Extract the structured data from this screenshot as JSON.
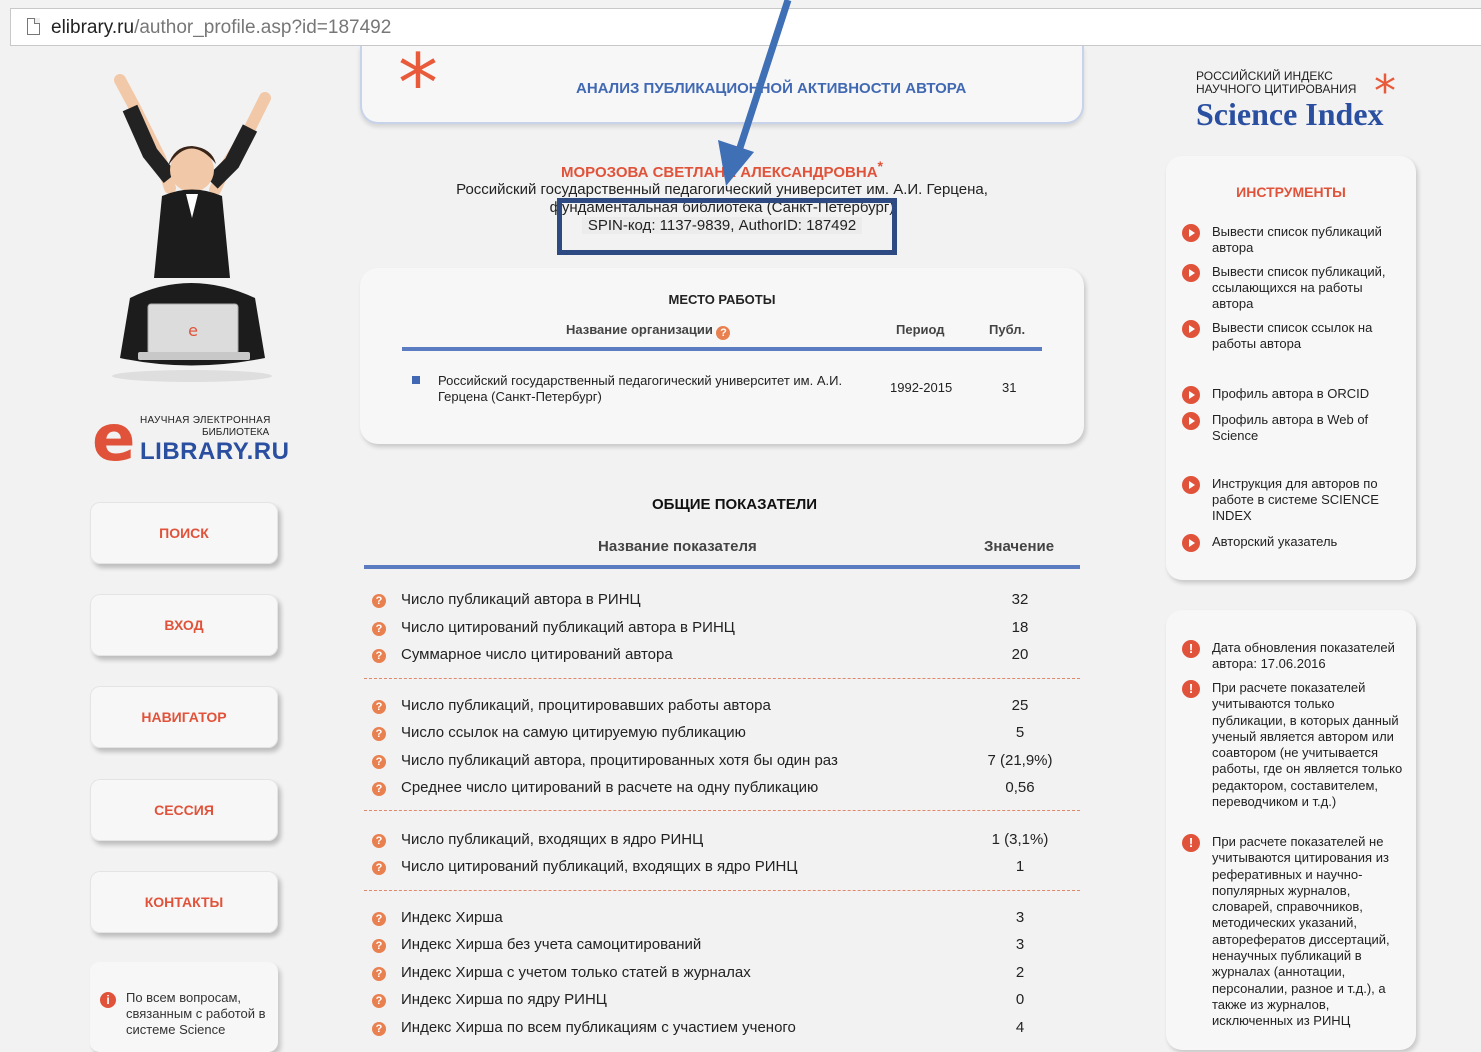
{
  "browser": {
    "url_host": "elibrary.ru",
    "url_path": "/author_profile.asp?id=187492"
  },
  "left": {
    "logo": {
      "line1": "НАУЧНАЯ ЭЛЕКТРОННАЯ",
      "line2": "БИБЛИОТЕКА",
      "brand": "LIBRARY.RU"
    },
    "nav": [
      "ПОИСК",
      "ВХОД",
      "НАВИГАТОР",
      "СЕССИЯ",
      "КОНТАКТЫ"
    ],
    "info": "По всем вопросам, связанным с работой в системе Science"
  },
  "header": {
    "title": "АНАЛИЗ ПУБЛИКАЦИОННОЙ АКТИВНОСТИ АВТОРА"
  },
  "author": {
    "name": "МОРОЗОВА СВЕТЛАНА АЛЕКСАНДРОВНА",
    "star": "*",
    "aff1": "Российский государственный педагогический университет им. А.И. Герцена,",
    "aff2": "фундаментальная библиотека (Санкт-Петербург)",
    "spin": "SPIN-код: 1137-9839, AuthorID: 187492"
  },
  "work": {
    "title": "МЕСТО РАБОТЫ",
    "col_name": "Название организации",
    "col_period": "Период",
    "col_pub": "Публ.",
    "org": "Российский государственный педагогический университет им. А.И. Герцена (Санкт-Петербург)",
    "period": "1992-2015",
    "pub": "31"
  },
  "general": {
    "title": "ОБЩИЕ ПОКАЗАТЕЛИ",
    "col_name": "Название показателя",
    "col_value": "Значение",
    "rows": [
      {
        "label": "Число публикаций автора в РИНЦ",
        "value": "32"
      },
      {
        "label": "Число цитирований публикаций автора в РИНЦ",
        "value": "18"
      },
      {
        "label": "Суммарное число цитирований автора",
        "value": "20"
      },
      {
        "label": "Число публикаций, процитировавших работы автора",
        "value": "25"
      },
      {
        "label": "Число ссылок на самую цитируемую публикацию",
        "value": "5"
      },
      {
        "label": "Число публикаций автора, процитированных хотя бы один раз",
        "value": "7 (21,9%)"
      },
      {
        "label": "Среднее число цитирований в расчете на одну публикацию",
        "value": "0,56"
      },
      {
        "label": "Число публикаций, входящих в ядро РИНЦ",
        "value": "1 (3,1%)"
      },
      {
        "label": "Число цитирований публикаций, входящих в ядро РИНЦ",
        "value": "1"
      },
      {
        "label": "Индекс Хирша",
        "value": "3"
      },
      {
        "label": "Индекс Хирша без учета самоцитирований",
        "value": "3"
      },
      {
        "label": "Индекс Хирша с учетом только статей в журналах",
        "value": "2"
      },
      {
        "label": "Индекс Хирша по ядру РИНЦ",
        "value": "0"
      },
      {
        "label": "Индекс Хирша по всем публикациям с участием ученого",
        "value": "4"
      }
    ]
  },
  "science_index": {
    "line1": "РОССИЙСКИЙ ИНДЕКС",
    "line2": "НАУЧНОГО ЦИТИРОВАНИЯ",
    "brand": "Science Index"
  },
  "tools": {
    "title": "ИНСТРУМЕНТЫ",
    "items": [
      "Вывести список публикаций автора",
      "Вывести список публикаций, ссылающихся на работы автора",
      "Вывести список ссылок на работы автора",
      "Профиль автора в ORCID",
      "Профиль автора в Web of Science",
      "Инструкция для авторов по работе в системе SCIENCE INDEX",
      "Авторский указатель"
    ]
  },
  "notes": [
    "Дата обновления показателей автора: 17.06.2016",
    "При расчете показателей учитываются только публикации, в которых данный ученый является автором или соавтором (не учитывается работы, где он является только редактором, составителем, переводчиком и т.д.)",
    "При расчете показателей не учитываются цитирования из реферативных и научно-популярных журналов, словарей, справочников, методических указаний, авторефератов диссертаций, ненаучных публикаций в журналах (аннотации, персоналии, разное и т.д.), а также из журналов, исключенных из РИНЦ"
  ]
}
